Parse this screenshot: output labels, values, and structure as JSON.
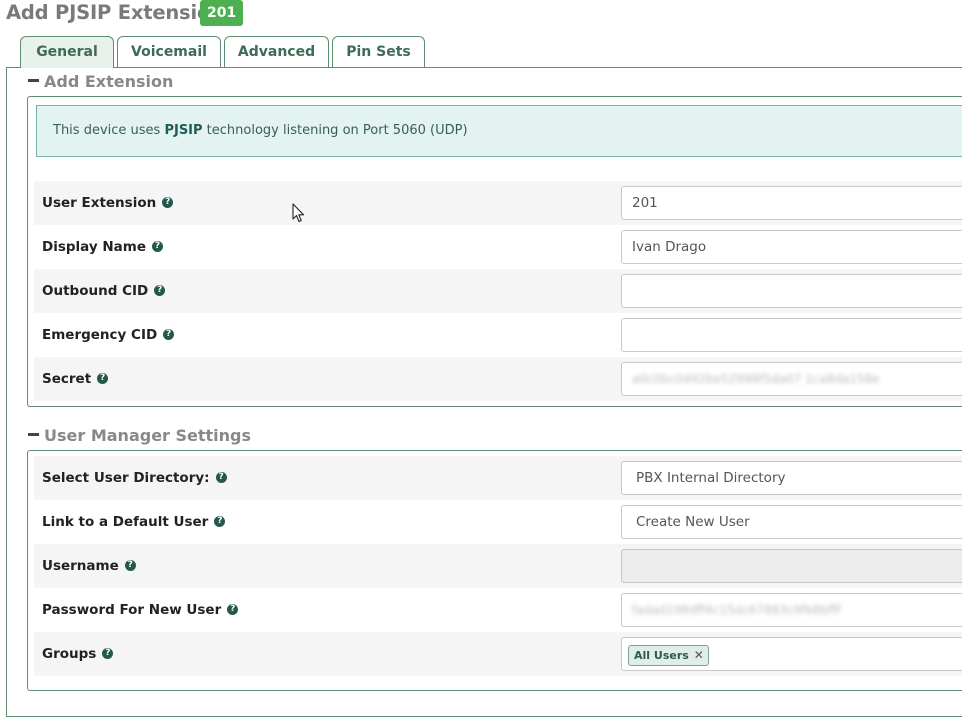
{
  "header": {
    "title": "Add PJSIP Extension",
    "extension_badge": "201"
  },
  "tabs": [
    {
      "label": "General",
      "active": true
    },
    {
      "label": "Voicemail",
      "active": false
    },
    {
      "label": "Advanced",
      "active": false
    },
    {
      "label": "Pin Sets",
      "active": false
    }
  ],
  "add_extension": {
    "title": "Add Extension",
    "info_prefix": "This device uses ",
    "info_tech": "PJSIP",
    "info_suffix": " technology listening on Port 5060 (UDP)",
    "fields": [
      {
        "label": "User Extension",
        "value": ""
      },
      {
        "label": "Display Name",
        "value": ""
      },
      {
        "label": "Outbound CID",
        "value": ""
      },
      {
        "label": "Emergency CID",
        "value": ""
      },
      {
        "label": "Secret",
        "value": ""
      }
    ],
    "user_extension_value": "201",
    "display_name_value": "Ivan Drago",
    "outbound_cid_value": "",
    "emergency_cid_value": "",
    "secret_value": "a0c0bc0d42be52998f5da07 1ca8da158e"
  },
  "user_manager": {
    "title": "User Manager Settings",
    "select_directory_label": "Select User Directory:",
    "select_directory_value": "PBX Internal Directory",
    "link_default_user_label": "Link to a Default User",
    "link_default_user_value": "Create New User",
    "username_label": "Username",
    "username_value": "",
    "password_label": "Password For New User",
    "password_value": "fadad198dff4c15dc67883c9fb8bfff",
    "groups_label": "Groups",
    "groups_tag": "All Users"
  },
  "icons": {
    "help": "?",
    "tag_remove": "✕"
  },
  "colors": {
    "accent": "#5f8d72",
    "badge": "#4caf50",
    "alert_bg": "#e3f3f1"
  }
}
